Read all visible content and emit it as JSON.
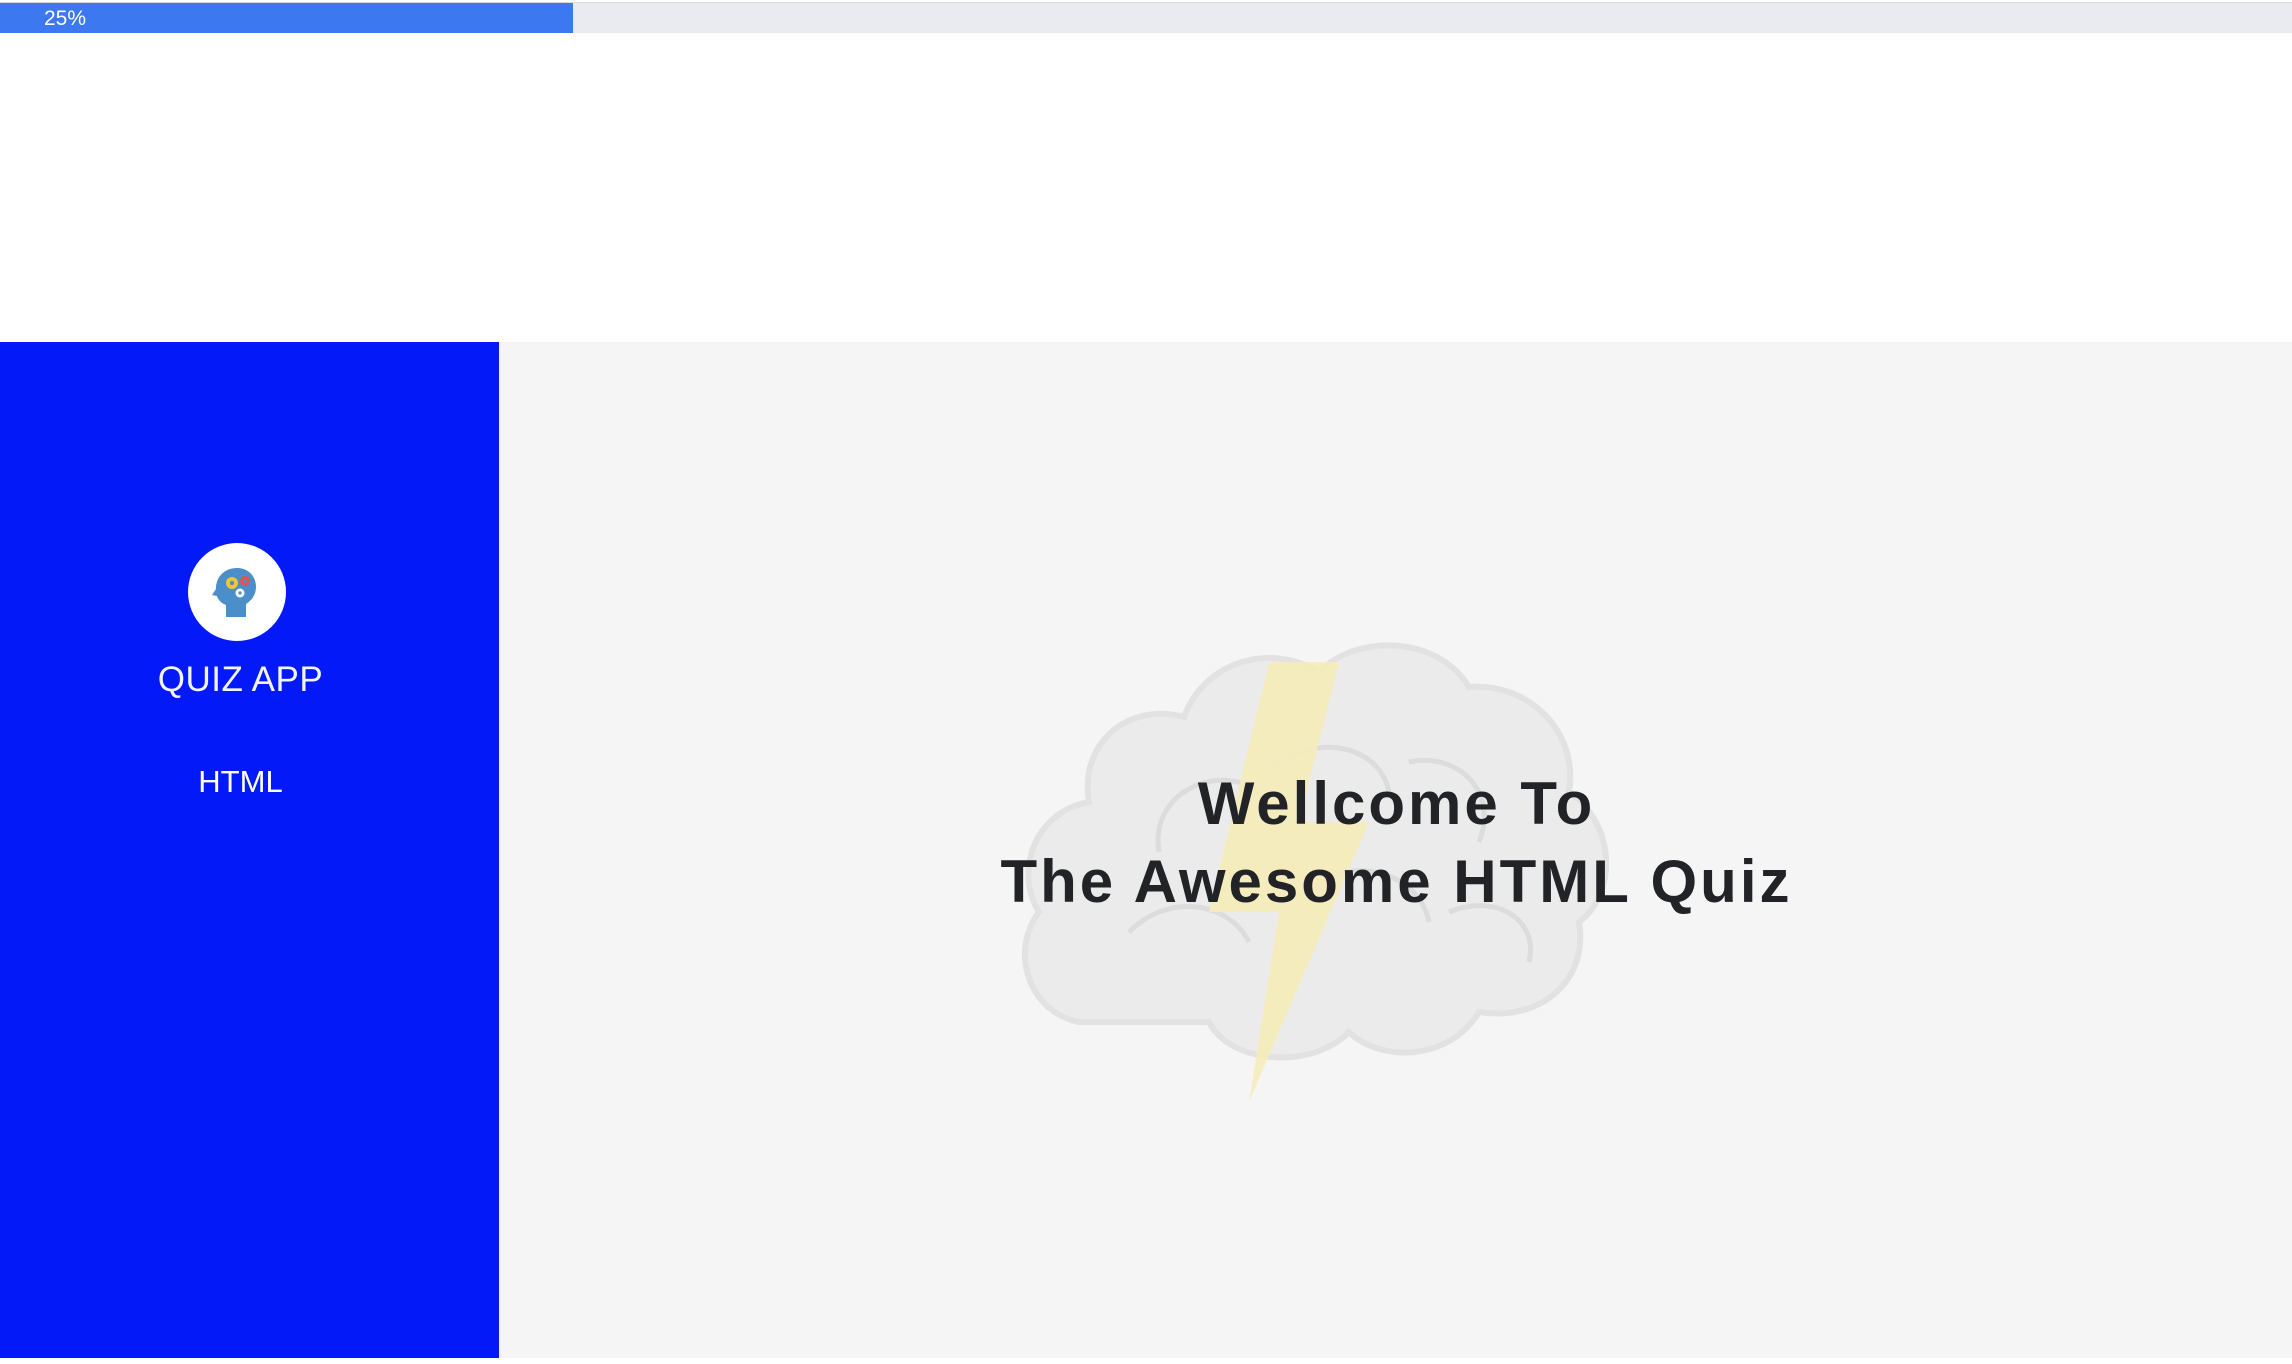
{
  "progress": {
    "label": "25%",
    "value": 0.25,
    "fill_color": "#3c78f0",
    "track_color": "#e9ebf0"
  },
  "sidebar": {
    "background": "#0419f7",
    "logo_icon": "brain-head-icon",
    "app_title": "QUIZ APP",
    "nav_items": [
      {
        "label": "HTML"
      }
    ]
  },
  "main": {
    "watermark_icon": "brain-lightning-icon",
    "welcome_line1": "Wellcome To",
    "welcome_line2": "The Awesome HTML Quiz"
  }
}
